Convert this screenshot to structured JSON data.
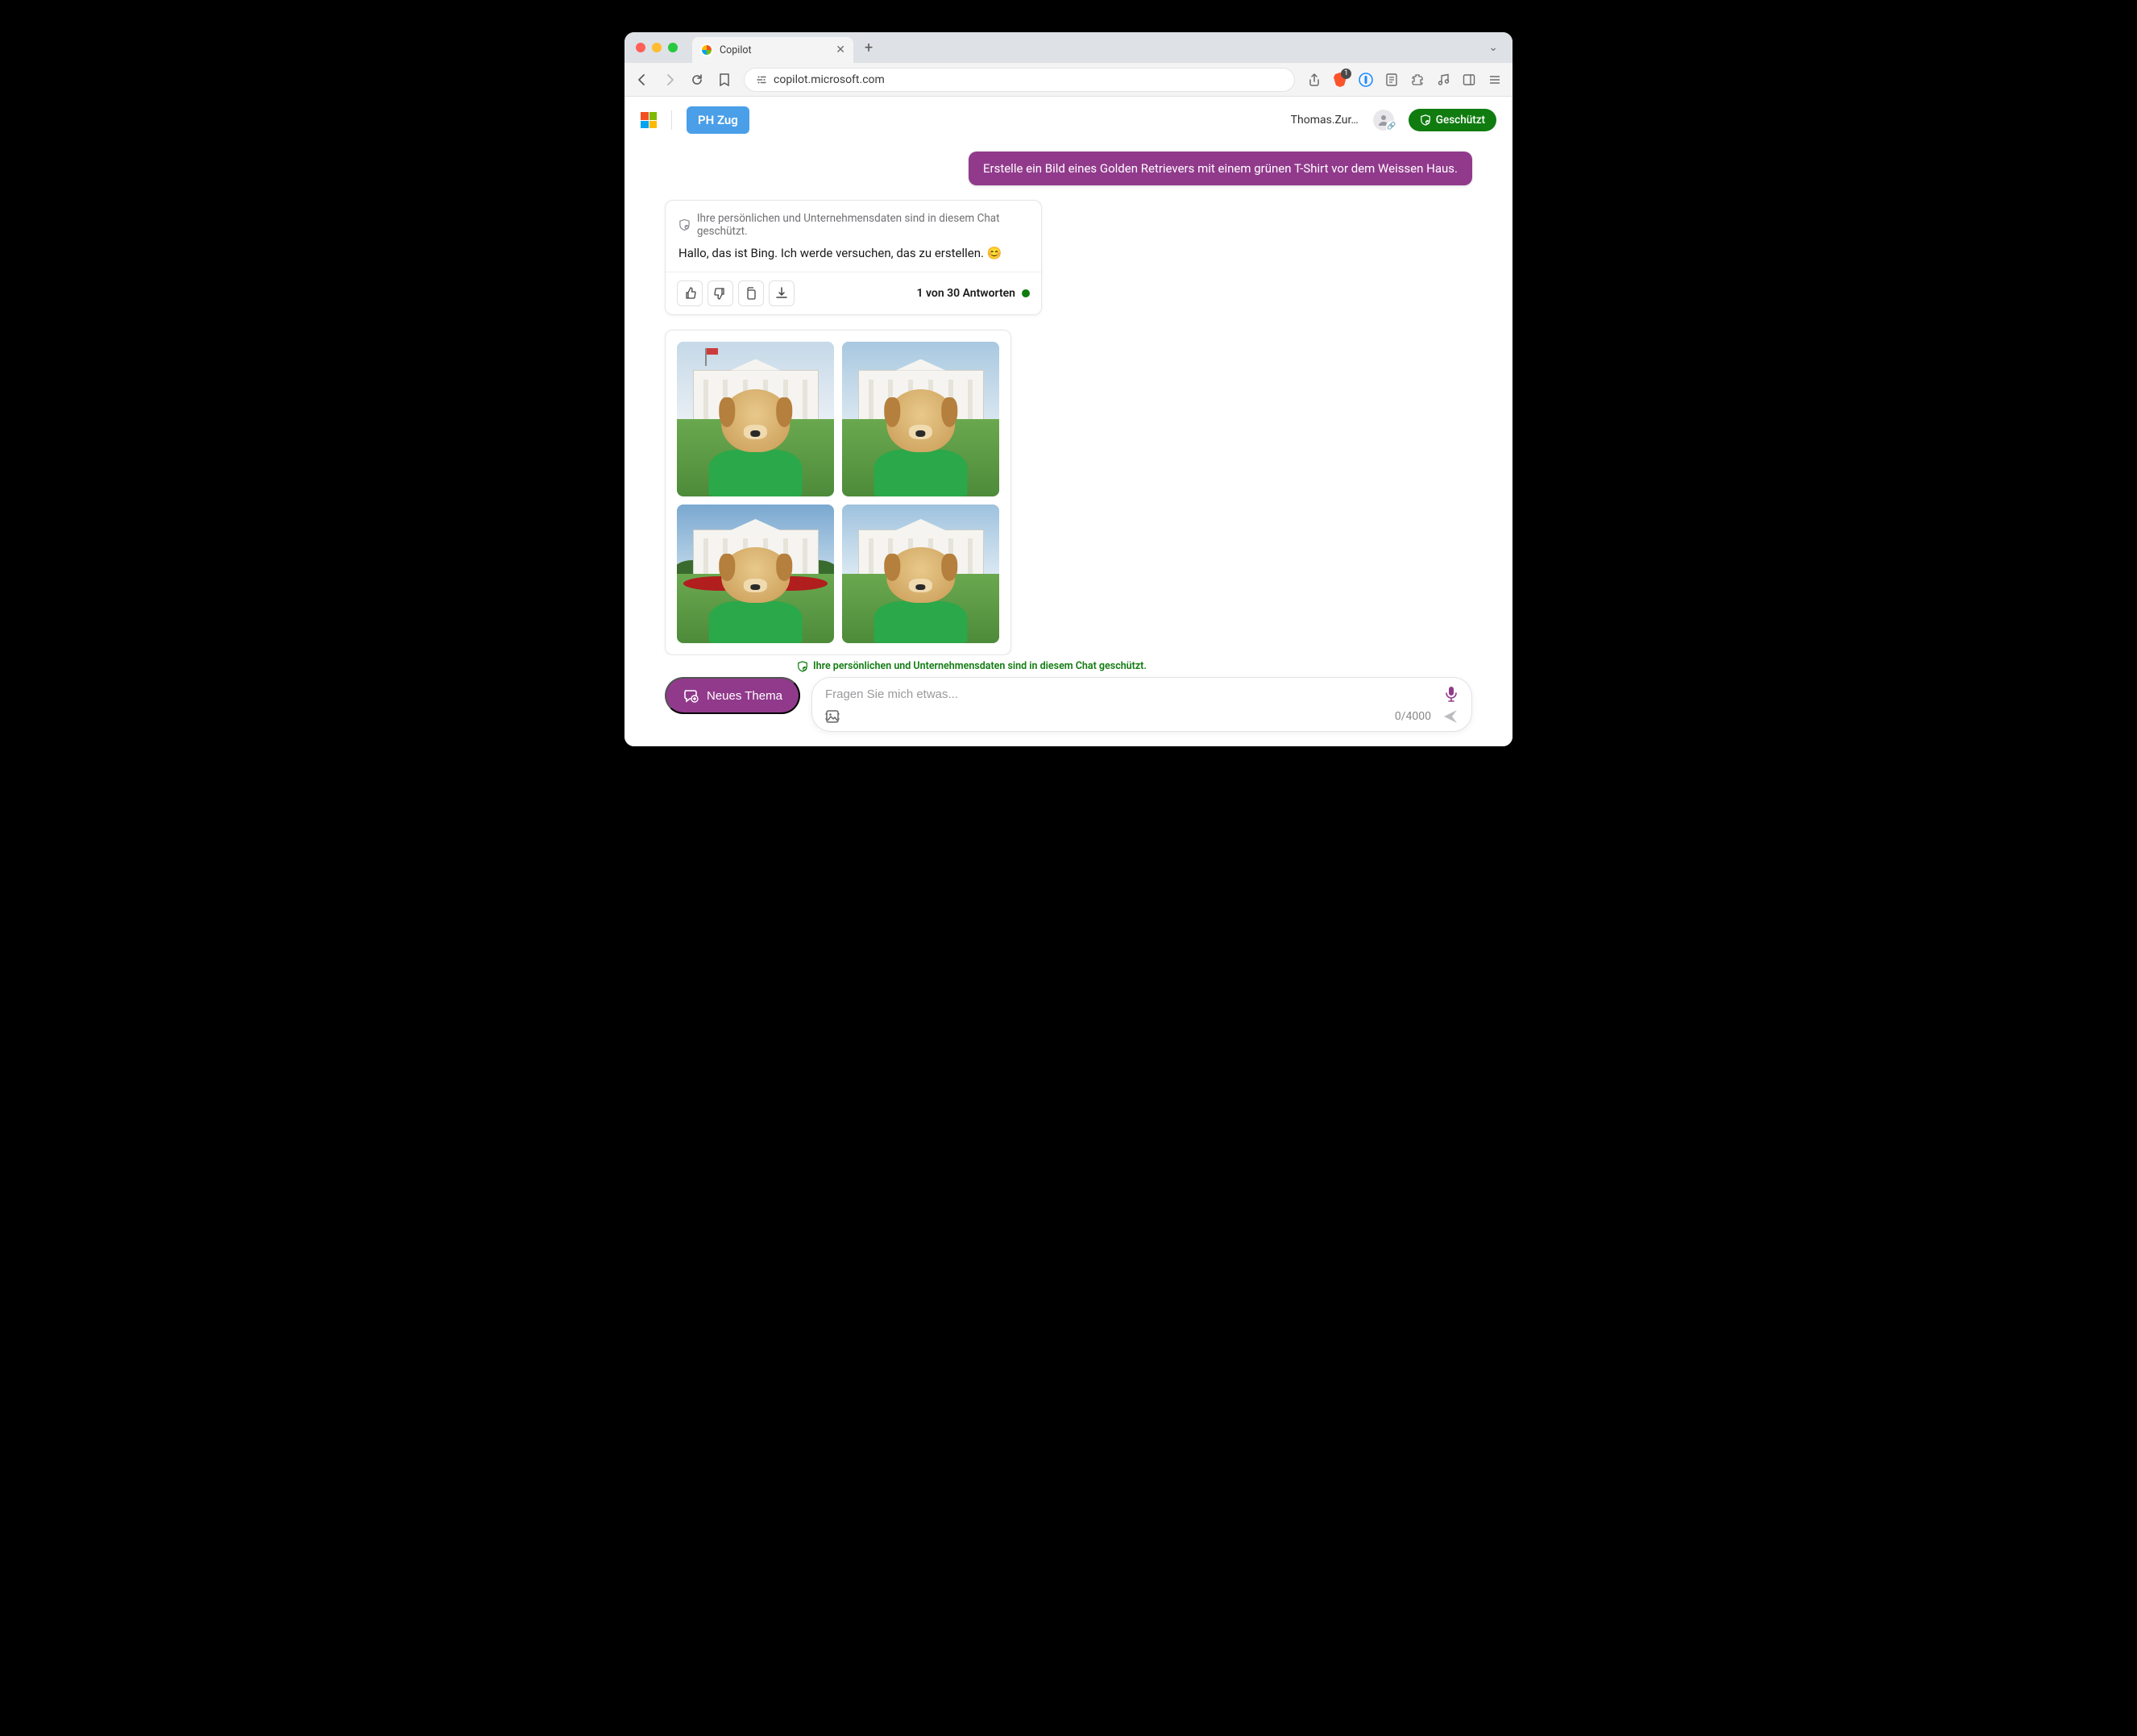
{
  "browser": {
    "tab_title": "Copilot",
    "url": "copilot.microsoft.com",
    "brave_badge": "1"
  },
  "header": {
    "org_badge": "PH Zug",
    "username": "Thomas.Zur…",
    "protected_label": "Geschützt"
  },
  "chat": {
    "user_message": "Erstelle ein Bild eines Golden Retrievers mit einem grünen T-Shirt vor dem Weissen Haus.",
    "privacy_notice": "Ihre persönlichen und Unternehmensdaten sind in diesem Chat geschützt.",
    "ai_message": "Hallo, das ist Bing. Ich werde versuchen, das zu erstellen. 😊",
    "answer_counter": "1 von 30 Antworten"
  },
  "composer": {
    "privacy_line": "Ihre persönlichen und Unternehmensdaten sind in diesem Chat geschützt.",
    "new_topic_label": "Neues Thema",
    "placeholder": "Fragen Sie mich etwas...",
    "char_counter": "0/4000"
  }
}
